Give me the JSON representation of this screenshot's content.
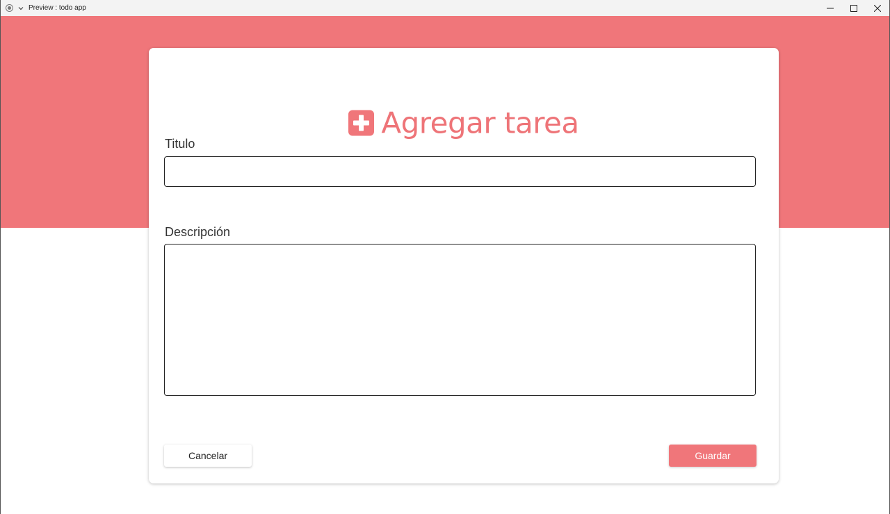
{
  "window": {
    "title": "Preview : todo app",
    "controls": [
      "minimize",
      "maximize",
      "close"
    ]
  },
  "colors": {
    "accent": "#f0767a",
    "card_background": "#ffffff",
    "titlebar": "#f3f3f3"
  },
  "form": {
    "heading": "Agregar tarea",
    "heading_icon": "plus-square-icon",
    "title_label": "Titulo",
    "title_value": "",
    "description_label": "Descripción",
    "description_value": "",
    "cancel_label": "Cancelar",
    "save_label": "Guardar"
  }
}
